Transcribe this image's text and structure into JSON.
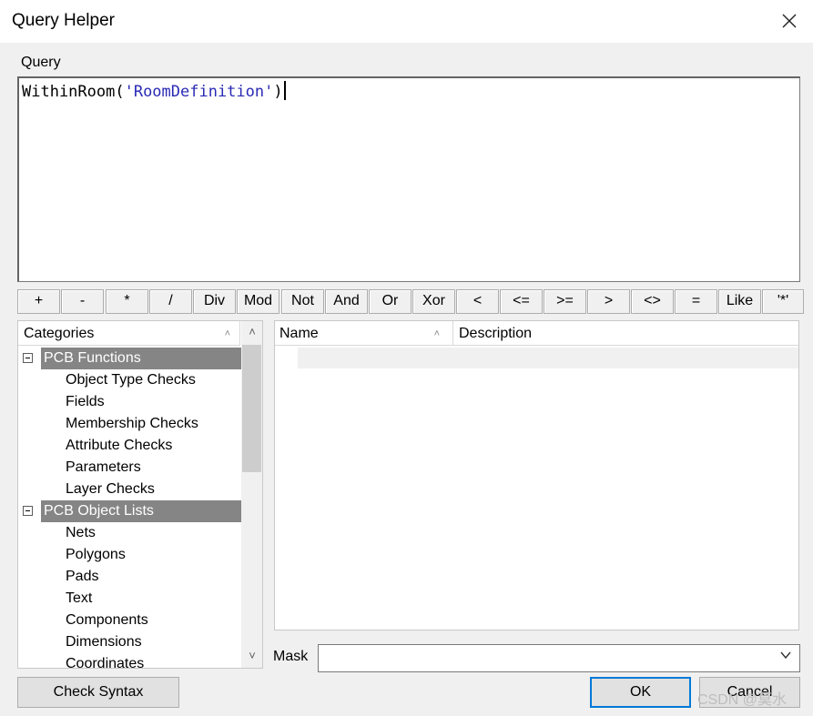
{
  "window": {
    "title": "Query Helper",
    "close_icon": "close-icon"
  },
  "query": {
    "label": "Query",
    "code_func": "WithinRoom(",
    "code_str": "'RoomDefinition'",
    "code_end": ")"
  },
  "operators": [
    "+",
    "-",
    "*",
    "/",
    "Div",
    "Mod",
    "Not",
    "And",
    "Or",
    "Xor",
    "<",
    "<=",
    ">=",
    ">",
    "<>",
    "=",
    "Like",
    "'*'"
  ],
  "categories": {
    "header": "Categories",
    "groups": [
      {
        "label": "PCB Functions",
        "items": [
          "Object Type Checks",
          "Fields",
          "Membership Checks",
          "Attribute Checks",
          "Parameters",
          "Layer Checks"
        ]
      },
      {
        "label": "PCB Object Lists",
        "items": [
          "Nets",
          "Polygons",
          "Pads",
          "Text",
          "Components",
          "Dimensions",
          "Coordinates"
        ]
      }
    ]
  },
  "list": {
    "col_name": "Name",
    "col_description": "Description"
  },
  "mask": {
    "label": "Mask",
    "value": ""
  },
  "buttons": {
    "check_syntax": "Check Syntax",
    "ok": "OK",
    "cancel": "Cancel"
  },
  "watermark": "CSDN @莫水",
  "colors": {
    "group_bg": "#858585",
    "string_color": "#2a2ab5",
    "ok_border": "#0078d7"
  }
}
